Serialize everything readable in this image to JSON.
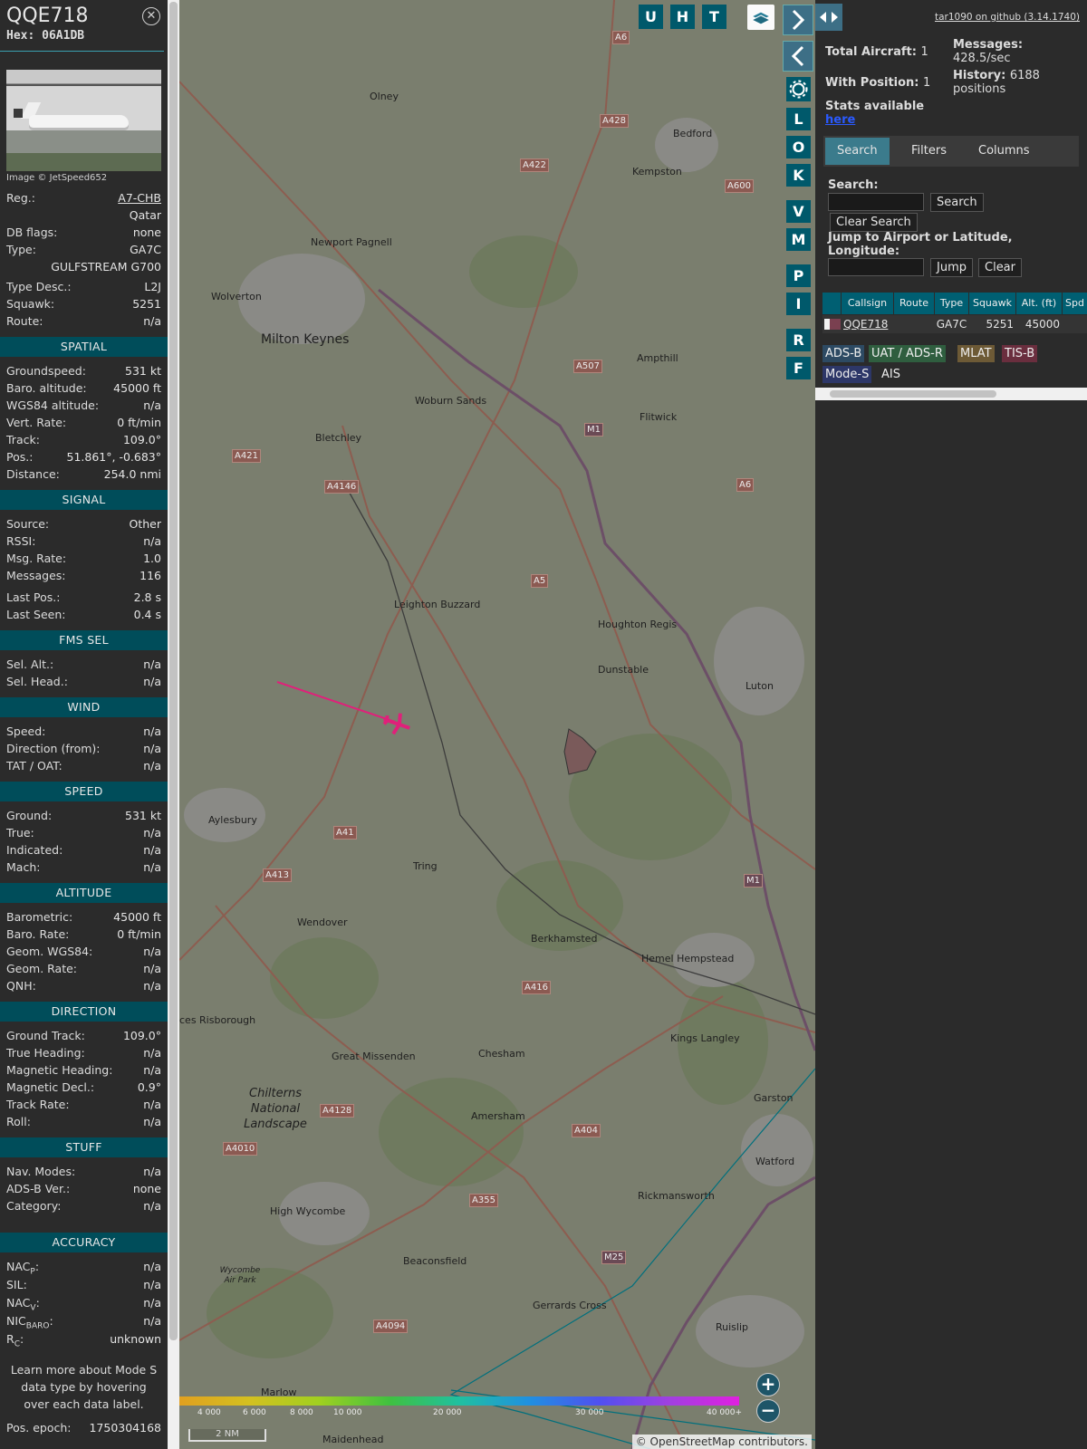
{
  "aircraft": {
    "callsign": "QQE718",
    "hex_label": "Hex: 06A1DB",
    "image_credit": "Image © JetSpeed652",
    "reg_label": "Reg.:",
    "reg": "A7-CHB",
    "country": "Qatar",
    "dbflags_label": "DB flags:",
    "dbflags": "none",
    "type_label": "Type:",
    "type": "GA7C",
    "type_full": "GULFSTREAM G700",
    "typedesc_label": "Type Desc.:",
    "typedesc": "L2J",
    "squawk_label": "Squawk:",
    "squawk": "5251",
    "route_label": "Route:",
    "route": "n/a"
  },
  "sections": {
    "spatial": {
      "title": "SPATIAL",
      "rows": [
        {
          "label": "Groundspeed:",
          "value": "531 kt"
        },
        {
          "label": "Baro. altitude:",
          "value": "45000 ft"
        },
        {
          "label": "WGS84 altitude:",
          "value": "n/a"
        },
        {
          "label": "Vert. Rate:",
          "value": "0 ft/min"
        },
        {
          "label": "Track:",
          "value": "109.0°"
        },
        {
          "label": "Pos.:",
          "value": "51.861°, -0.683°"
        },
        {
          "label": "Distance:",
          "value": "254.0 nmi"
        }
      ]
    },
    "signal": {
      "title": "SIGNAL",
      "rows": [
        {
          "label": "Source:",
          "value": "Other"
        },
        {
          "label": "RSSI:",
          "value": "n/a"
        },
        {
          "label": "Msg. Rate:",
          "value": "1.0"
        },
        {
          "label": "Messages:",
          "value": "116"
        },
        {
          "label": "Last Pos.:",
          "value": "2.8 s"
        },
        {
          "label": "Last Seen:",
          "value": "0.4 s"
        }
      ]
    },
    "fms": {
      "title": "FMS SEL",
      "rows": [
        {
          "label": "Sel. Alt.:",
          "value": "n/a"
        },
        {
          "label": "Sel. Head.:",
          "value": "n/a"
        }
      ]
    },
    "wind": {
      "title": "WIND",
      "rows": [
        {
          "label": "Speed:",
          "value": "n/a"
        },
        {
          "label": "Direction (from):",
          "value": "n/a"
        },
        {
          "label": "TAT / OAT:",
          "value": "n/a"
        }
      ]
    },
    "speed": {
      "title": "SPEED",
      "rows": [
        {
          "label": "Ground:",
          "value": "531 kt"
        },
        {
          "label": "True:",
          "value": "n/a"
        },
        {
          "label": "Indicated:",
          "value": "n/a"
        },
        {
          "label": "Mach:",
          "value": "n/a"
        }
      ]
    },
    "altitude": {
      "title": "ALTITUDE",
      "rows": [
        {
          "label": "Barometric:",
          "value": "45000 ft"
        },
        {
          "label": "Baro. Rate:",
          "value": "0 ft/min"
        },
        {
          "label": "Geom. WGS84:",
          "value": "n/a"
        },
        {
          "label": "Geom. Rate:",
          "value": "n/a"
        },
        {
          "label": "QNH:",
          "value": "n/a"
        }
      ]
    },
    "direction": {
      "title": "DIRECTION",
      "rows": [
        {
          "label": "Ground Track:",
          "value": "109.0°"
        },
        {
          "label": "True Heading:",
          "value": "n/a"
        },
        {
          "label": "Magnetic Heading:",
          "value": "n/a"
        },
        {
          "label": "Magnetic Decl.:",
          "value": "0.9°"
        },
        {
          "label": "Track Rate:",
          "value": "n/a"
        },
        {
          "label": "Roll:",
          "value": "n/a"
        }
      ]
    },
    "stuff": {
      "title": "STUFF",
      "rows": [
        {
          "label": "Nav. Modes:",
          "value": "n/a"
        },
        {
          "label": "ADS-B Ver.:",
          "value": "none"
        },
        {
          "label": "Category:",
          "value": "n/a"
        }
      ]
    },
    "accuracy": {
      "title": "ACCURACY",
      "rows": [
        {
          "label": "NAC",
          "sub": "P",
          "value": "n/a"
        },
        {
          "label": "SIL:",
          "sub": "",
          "value": "n/a"
        },
        {
          "label": "NAC",
          "sub": "V",
          "value": "n/a"
        },
        {
          "label": "NIC",
          "sub": "BARO",
          "value": "n/a"
        },
        {
          "label": "R",
          "sub": "C",
          "value": "unknown"
        }
      ]
    }
  },
  "footer": {
    "note": "Learn more about Mode S data type by hovering over each data label.",
    "epoch_label": "Pos. epoch:",
    "epoch": "1750304168"
  },
  "map": {
    "top_buttons": [
      "U",
      "H",
      "T"
    ],
    "side_buttons": [
      "L",
      "O",
      "K",
      "V",
      "M",
      "P",
      "I",
      "R",
      "F"
    ],
    "attribution": "© OpenStreetMap contributors.",
    "scale": "2 NM",
    "altitude_scale": [
      "4 000",
      "6 000",
      "8 000",
      "10 000",
      "20 000",
      "30 000",
      "40 000+"
    ],
    "places": [
      {
        "name": "Olney"
      },
      {
        "name": "Bedford"
      },
      {
        "name": "Kempston"
      },
      {
        "name": "Newport Pagnell"
      },
      {
        "name": "Wolverton"
      },
      {
        "name": "Milton Keynes"
      },
      {
        "name": "Ampthill"
      },
      {
        "name": "Woburn Sands"
      },
      {
        "name": "Flitwick"
      },
      {
        "name": "Bletchley"
      },
      {
        "name": "Leighton Buzzard"
      },
      {
        "name": "Houghton Regis"
      },
      {
        "name": "Dunstable"
      },
      {
        "name": "Luton"
      },
      {
        "name": "Aylesbury"
      },
      {
        "name": "Tring"
      },
      {
        "name": "Wendover"
      },
      {
        "name": "Berkhamsted"
      },
      {
        "name": "Hemel Hempstead"
      },
      {
        "name": "ces Risborough"
      },
      {
        "name": "Great Missenden"
      },
      {
        "name": "Chesham"
      },
      {
        "name": "Kings Langley"
      },
      {
        "name": "Amersham"
      },
      {
        "name": "Garston"
      },
      {
        "name": "Watford"
      },
      {
        "name": "High Wycombe"
      },
      {
        "name": "Rickmansworth"
      },
      {
        "name": "Beaconsfield"
      },
      {
        "name": "Gerrards Cross"
      },
      {
        "name": "Ruislip"
      },
      {
        "name": "Marlow"
      },
      {
        "name": "Maidenhead"
      },
      {
        "name": "Chilterns National Landscape"
      },
      {
        "name": "Wycombe Air Park"
      }
    ],
    "roads": [
      "A6",
      "A428",
      "A422",
      "A600",
      "A421",
      "A4146",
      "A507",
      "M1",
      "A5",
      "A41",
      "A413",
      "A416",
      "A4128",
      "A4010",
      "A404",
      "A355",
      "M25",
      "A4094",
      "A6",
      "M1"
    ]
  },
  "stats": {
    "total_label": "Total Aircraft:",
    "total": "1",
    "position_label": "With Position:",
    "position": "1",
    "messages_label": "Messages:",
    "messages": "428.5/sec",
    "history_label": "History:",
    "history": "6188 positions",
    "stats_label": "Stats available",
    "stats_link": "here",
    "version": "tar1090 on github (3.14.1740)"
  },
  "tabs": [
    "Search",
    "Filters",
    "Columns"
  ],
  "search": {
    "search_label": "Search:",
    "search_button": "Search",
    "clear_button": "Clear Search",
    "jump_label": "Jump to Airport or Latitude, Longitude:",
    "jump_button": "Jump",
    "jump_clear": "Clear"
  },
  "table": {
    "headers": [
      "Callsign",
      "Route",
      "Type",
      "Squawk",
      "Alt. (ft)",
      "Spd"
    ],
    "row": {
      "callsign": "QQE718",
      "type": "GA7C",
      "squawk": "5251",
      "alt": "45000"
    }
  },
  "sources": [
    {
      "name": "ADS-B",
      "color": "#2d4a63"
    },
    {
      "name": "UAT / ADS-R",
      "color": "#2f5e3f"
    },
    {
      "name": "MLAT",
      "color": "#6d5a36"
    },
    {
      "name": "TIS-B",
      "color": "#6a2e3e"
    },
    {
      "name": "Mode-S",
      "color": "#2d3768"
    },
    {
      "name": "AIS",
      "color": "#2b2b2b"
    }
  ],
  "colors": {
    "accent": "#00596b",
    "track": "#e0207a"
  }
}
